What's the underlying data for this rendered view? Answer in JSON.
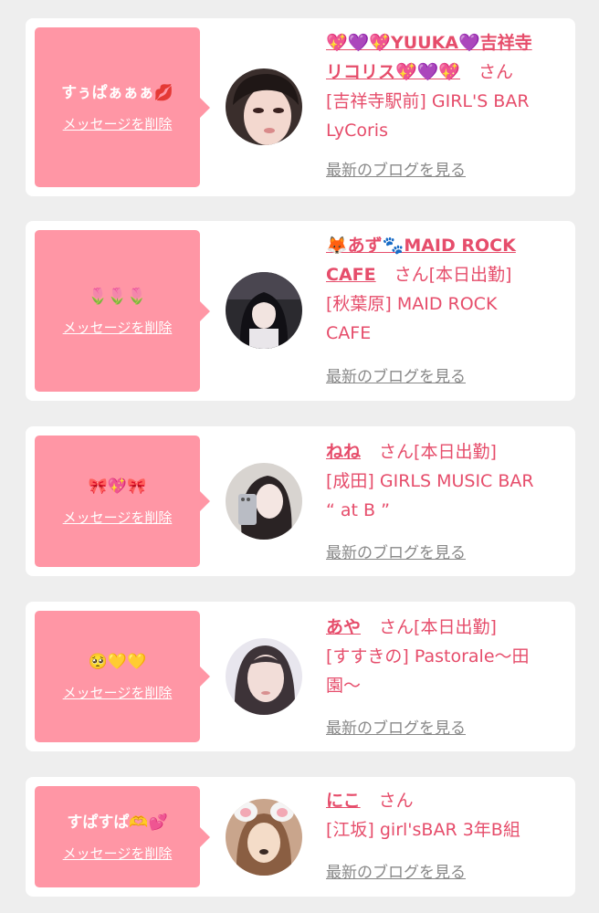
{
  "cards": [
    {
      "message": "すぅぱぁぁぁ💋",
      "delete_label": "メッセージを削除",
      "name_lines": [
        "💖💜💖YUUKA💜吉祥寺",
        "リコリス💖💜💖"
      ],
      "honorific": "さん",
      "status": "",
      "shop_lines": [
        "[吉祥寺駅前] GIRL'S BAR",
        "LyCoris"
      ],
      "blog_label": "最新のブログを見る",
      "avatar_icon": "profile-photo"
    },
    {
      "message": "🌷🌷🌷",
      "delete_label": "メッセージを削除",
      "name_lines": [
        "🦊あず🐾MAID ROCK",
        "CAFE"
      ],
      "honorific": "さん",
      "status": "[本日出勤]",
      "shop_lines": [
        "[秋葉原] MAID ROCK",
        "CAFE"
      ],
      "blog_label": "最新のブログを見る",
      "avatar_icon": "profile-photo"
    },
    {
      "message": "🎀💖🎀",
      "delete_label": "メッセージを削除",
      "name_lines": [
        "ねね"
      ],
      "honorific": "さん",
      "status": "[本日出勤]",
      "shop_lines": [
        "[成田] GIRLS MUSIC BAR",
        "“ at B ”"
      ],
      "blog_label": "最新のブログを見る",
      "avatar_icon": "profile-photo"
    },
    {
      "message": "🥺💛💛",
      "delete_label": "メッセージを削除",
      "name_lines": [
        "あや"
      ],
      "honorific": "さん",
      "status": "[本日出勤]",
      "shop_lines": [
        "[すすきの] Pastorale〜田",
        "園〜"
      ],
      "blog_label": "最新のブログを見る",
      "avatar_icon": "profile-photo"
    },
    {
      "message": "すぱすぱ🫶💕",
      "delete_label": "メッセージを削除",
      "name_lines": [
        "にこ"
      ],
      "honorific": "さん",
      "status": "",
      "shop_lines": [
        "[江坂] girl'sBAR 3年B組"
      ],
      "blog_label": "最新のブログを見る",
      "avatar_icon": "profile-photo"
    }
  ],
  "colors": {
    "bubble": "#ff96a5",
    "accent": "#e64d6b",
    "link_gray": "#888888",
    "card": "#ffffff",
    "page": "#eeeeee"
  }
}
